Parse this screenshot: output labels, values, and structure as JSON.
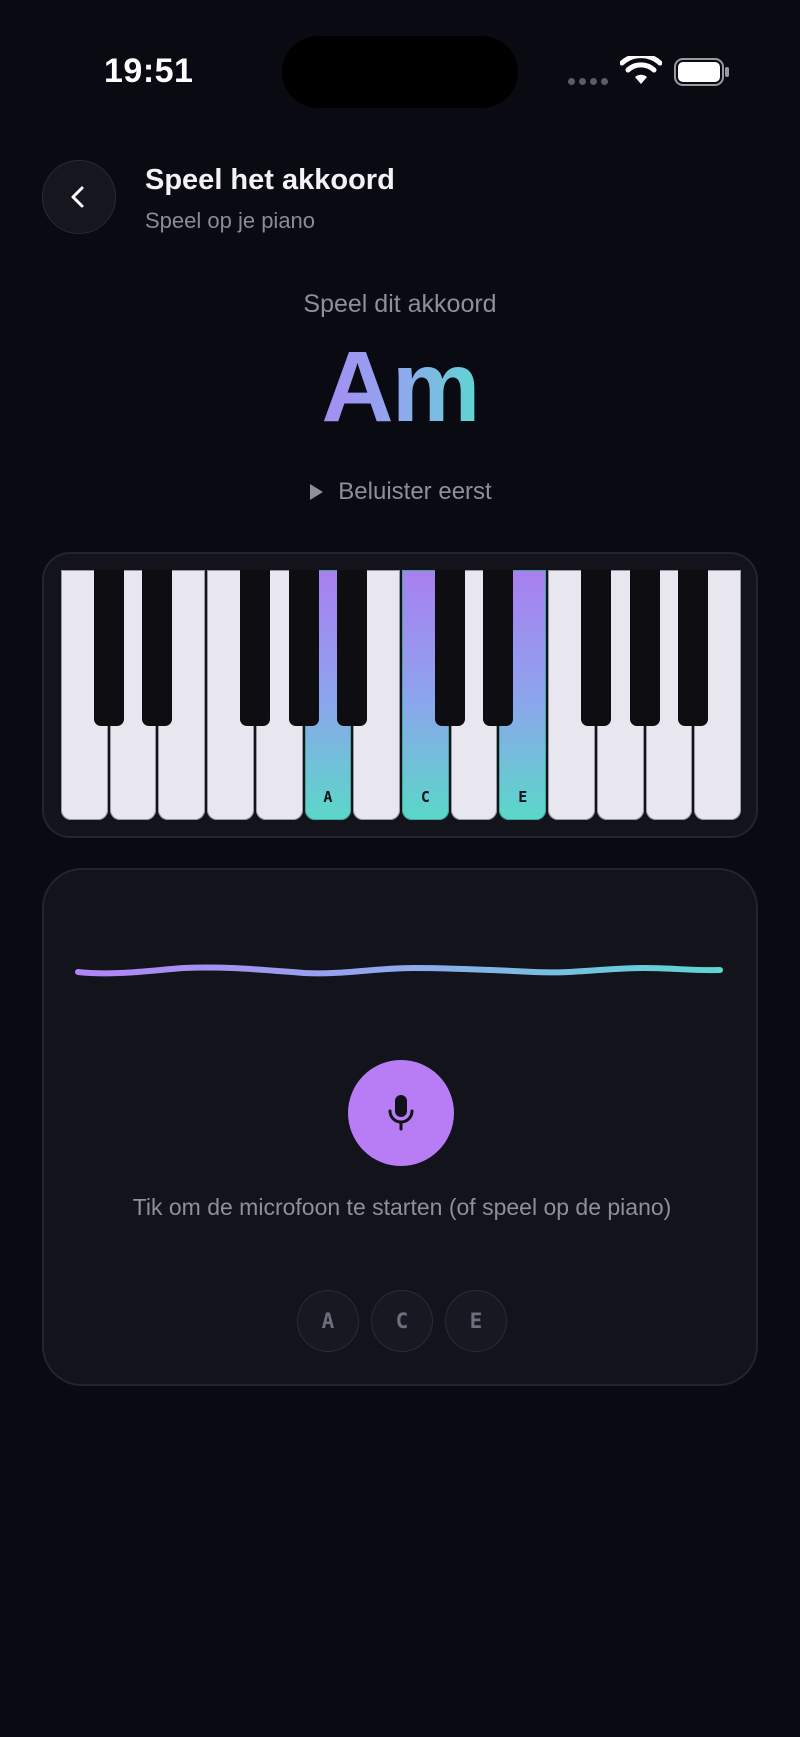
{
  "status_bar": {
    "time": "19:51",
    "wifi_icon": "wifi-icon",
    "battery_icon": "battery-icon"
  },
  "header": {
    "back_icon": "chevron-left-icon",
    "title": "Speel het akkoord",
    "subtitle": "Speel op je piano"
  },
  "prompt": {
    "label": "Speel dit akkoord",
    "chord": "Am",
    "listen_label": "Beluister eerst",
    "listen_icon": "play-icon"
  },
  "piano": {
    "white_keys": [
      "",
      "",
      "",
      "",
      "",
      "A",
      "",
      "C",
      "",
      "E",
      "",
      "",
      "",
      ""
    ],
    "active_keys": [
      5,
      7,
      9
    ],
    "black_key_after_white": [
      0,
      1,
      3,
      4,
      5,
      7,
      8,
      10,
      11,
      12
    ]
  },
  "listener": {
    "mic_icon": "microphone-icon",
    "hint": "Tik om de microfoon te starten (of speel op de piano)",
    "notes": [
      "A",
      "C",
      "E"
    ]
  },
  "colors": {
    "background": "#0a0a12",
    "card": "#13131c",
    "accent_purple": "#b87cf5",
    "accent_teal": "#5ed6d2"
  }
}
